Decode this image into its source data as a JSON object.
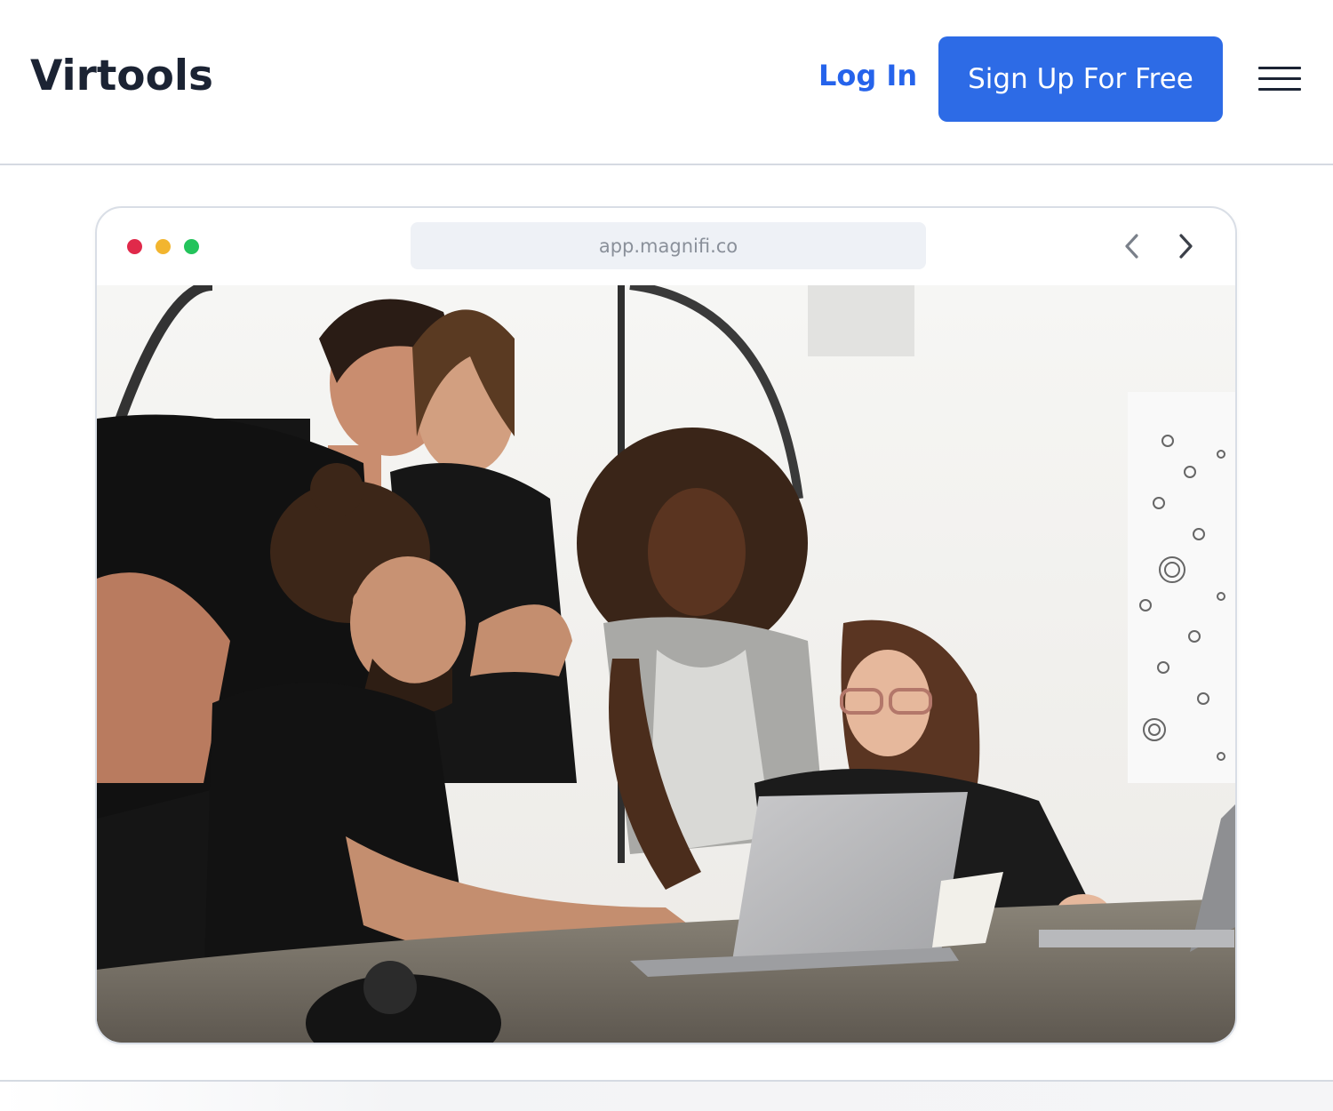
{
  "header": {
    "logo": "Virtools",
    "login_label": "Log In",
    "signup_label": "Sign Up For Free",
    "menu_icon": "hamburger-menu-icon"
  },
  "browser": {
    "url": "app.magnifi.co",
    "dots": [
      {
        "name": "close-dot",
        "color": "#e0294a"
      },
      {
        "name": "minimize-dot",
        "color": "#f2b52f"
      },
      {
        "name": "maximize-dot",
        "color": "#23c35b"
      }
    ],
    "back_icon": "chevron-left-icon",
    "forward_icon": "chevron-right-icon"
  },
  "hero_image": {
    "subject": "team-around-laptop"
  },
  "colors": {
    "brand": "#2d6be6",
    "link": "#2563eb",
    "text_dark": "#1b2333",
    "divider": "#d5dae2"
  }
}
